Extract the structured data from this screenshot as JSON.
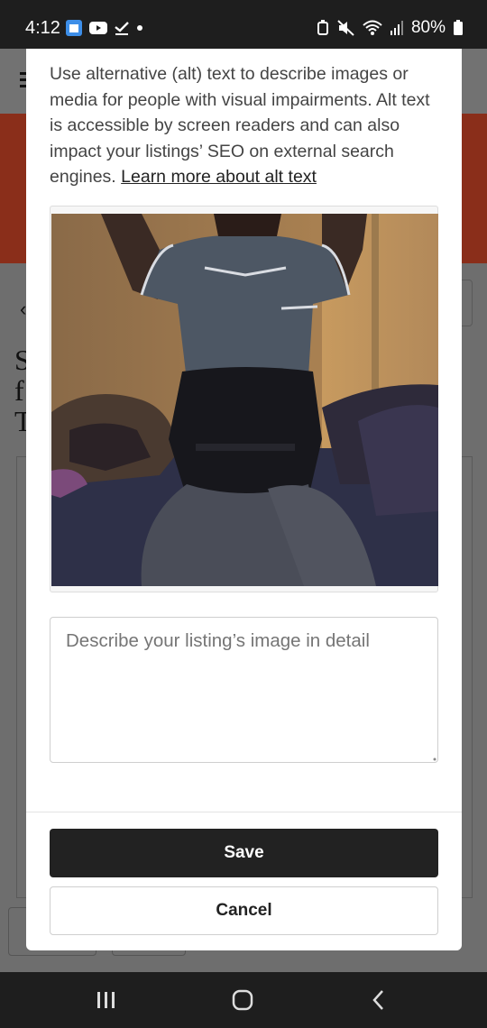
{
  "status_bar": {
    "time": "4:12",
    "battery": "80%",
    "icons": [
      "calendar-app-icon",
      "youtube-icon",
      "checkmark-icon",
      "dot-icon",
      "alarm-icon",
      "mute-icon",
      "wifi-icon",
      "signal-icon",
      "battery-icon"
    ]
  },
  "background_page": {
    "heading_fragments": [
      "S",
      "f",
      "T"
    ]
  },
  "modal": {
    "description_text": "Use alternative (alt) text to describe images or media for people with visual impairments. Alt text is accessible by screen readers and can also impact your listings’ SEO on external search engines. ",
    "learn_more_link": "Learn more about alt text",
    "alt_text_field": {
      "value": "",
      "placeholder": "Describe your listing’s image in detail"
    },
    "save_label": "Save",
    "cancel_label": "Cancel"
  },
  "nav_bar": {
    "icons": [
      "recent-apps-icon",
      "home-icon",
      "back-icon"
    ]
  }
}
